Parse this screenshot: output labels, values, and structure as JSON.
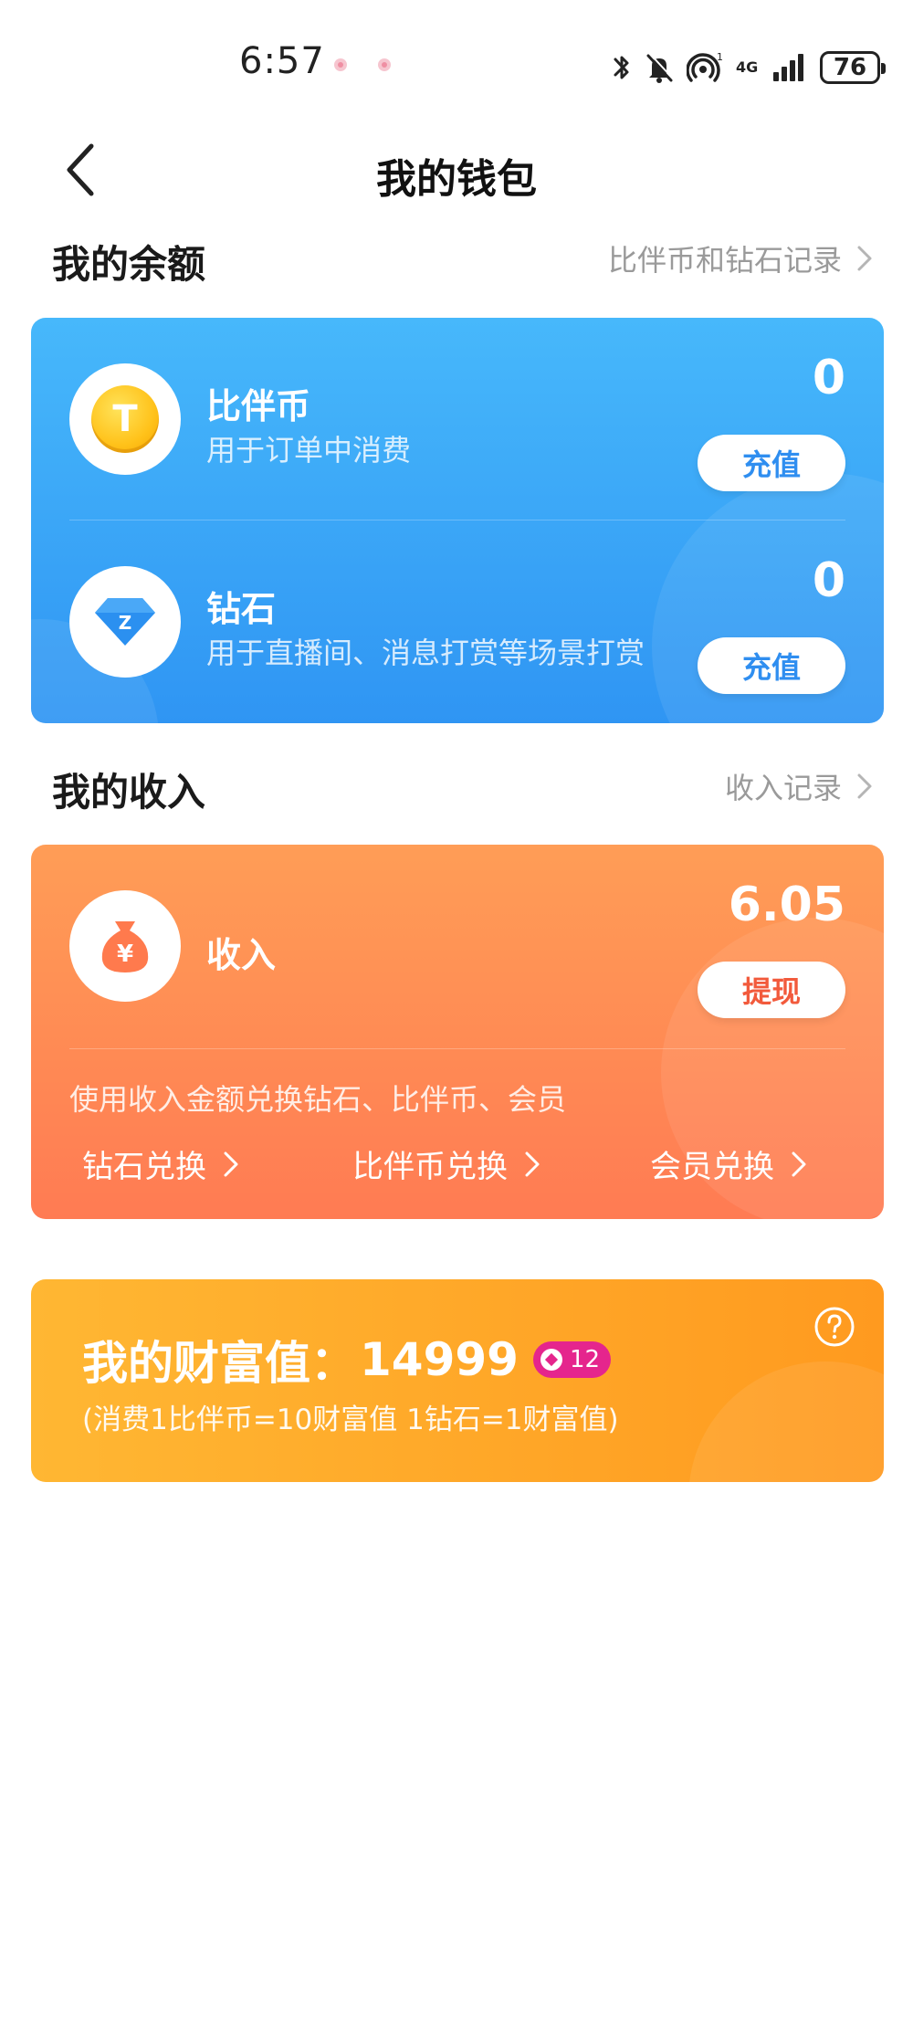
{
  "status_bar": {
    "time": "6:57",
    "network": "4G",
    "battery": "76"
  },
  "header": {
    "title": "我的钱包"
  },
  "balance_section": {
    "title": "我的余额",
    "link": "比伴币和钻石记录"
  },
  "balance_rows": [
    {
      "icon": "coin-icon",
      "title": "比伴币",
      "desc": "用于订单中消费",
      "amount": "0",
      "button": "充值"
    },
    {
      "icon": "diamond-icon",
      "title": "钻石",
      "desc": "用于直播间、消息打赏等场景打赏",
      "amount": "0",
      "button": "充值"
    }
  ],
  "income_section": {
    "title": "我的收入",
    "link": "收入记录"
  },
  "income_card": {
    "icon": "money-bag-icon",
    "title": "收入",
    "amount": "6.05",
    "button": "提现",
    "note": "使用收入金额兑换钻石、比伴币、会员",
    "links": [
      "钻石兑换",
      "比伴币兑换",
      "会员兑换"
    ]
  },
  "wealth_card": {
    "label": "我的财富值：",
    "value": "14999",
    "level": "12",
    "note": "(消费1比伴币=10财富值 1钻石=1财富值)"
  },
  "colors": {
    "blue_card": "#3aa6f8",
    "orange_card": "#ff8c55",
    "gold_card": "#ffa82a",
    "level_badge": "#e5258d"
  }
}
